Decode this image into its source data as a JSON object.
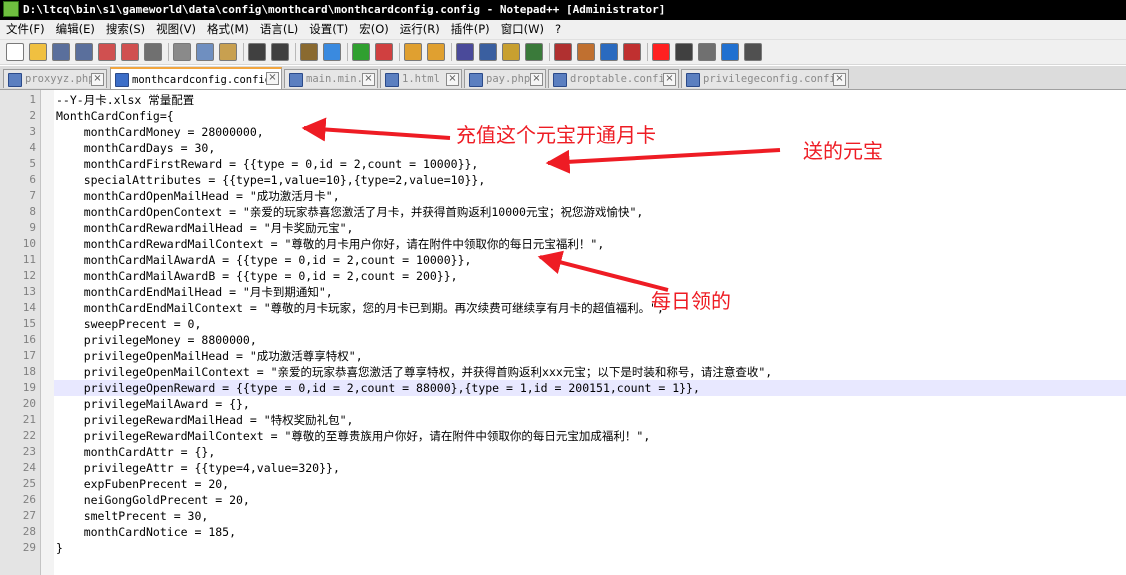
{
  "window": {
    "title": "D:\\ltcq\\bin\\s1\\gameworld\\data\\config\\monthcard\\monthcardconfig.config - Notepad++ [Administrator]"
  },
  "menu": [
    "文件(F)",
    "编辑(E)",
    "搜索(S)",
    "视图(V)",
    "格式(M)",
    "语言(L)",
    "设置(T)",
    "宏(O)",
    "运行(R)",
    "插件(P)",
    "窗口(W)",
    "?"
  ],
  "toolbar_icons": [
    "new-file-icon",
    "open-file-icon",
    "save-icon",
    "save-all-icon",
    "close-icon",
    "close-all-icon",
    "print-icon",
    "cut-icon",
    "copy-icon",
    "paste-icon",
    "undo-icon",
    "redo-icon",
    "find-icon",
    "replace-icon",
    "zoom-in-icon",
    "zoom-out-icon",
    "sync-vertical-icon",
    "sync-horizontal-icon",
    "word-wrap-icon",
    "show-all-chars-icon",
    "indent-guide-icon",
    "doc-map-icon",
    "function-list-icon",
    "folder-workspace-icon",
    "monitoring-icon",
    "preview-icon",
    "record-macro-icon",
    "stop-record-icon",
    "play-macro-icon",
    "run-macro-multiple-icon",
    "save-macro-icon"
  ],
  "tabs": [
    {
      "label": "proxyyz.php",
      "active": false
    },
    {
      "label": "monthcardconfig.config",
      "active": true
    },
    {
      "label": "main.min.js",
      "active": false
    },
    {
      "label": "1.html",
      "active": false
    },
    {
      "label": "pay.php",
      "active": false
    },
    {
      "label": "droptable.config",
      "active": false
    },
    {
      "label": "privilegeconfig.config",
      "active": false
    }
  ],
  "lines": [
    "--Y-月卡.xlsx 常量配置",
    "MonthCardConfig={",
    "    monthCardMoney = 28000000,",
    "    monthCardDays = 30,",
    "    monthCardFirstReward = {{type = 0,id = 2,count = 10000}},",
    "    specialAttributes = {{type=1,value=10},{type=2,value=10}},",
    "    monthCardOpenMailHead = \"成功激活月卡\",",
    "    monthCardOpenContext = \"亲爱的玩家恭喜您激活了月卡，并获得首购返利10000元宝；祝您游戏愉快\",",
    "    monthCardRewardMailHead = \"月卡奖励元宝\",",
    "    monthCardRewardMailContext = \"尊敬的月卡用户你好，请在附件中领取你的每日元宝福利！\",",
    "    monthCardMailAwardA = {{type = 0,id = 2,count = 10000}},",
    "    monthCardMailAwardB = {{type = 0,id = 2,count = 200}},",
    "    monthCardEndMailHead = \"月卡到期通知\",",
    "    monthCardEndMailContext = \"尊敬的月卡玩家，您的月卡已到期。再次续费可继续享有月卡的超值福利。\",",
    "    sweepPrecent = 0,",
    "    privilegeMoney = 8800000,",
    "    privilegeOpenMailHead = \"成功激活尊享特权\",",
    "    privilegeOpenMailContext = \"亲爱的玩家恭喜您激活了尊享特权，并获得首购返利xxx元宝；以下是时装和称号，请注意查收\",",
    "    privilegeOpenReward = {{type = 0,id = 2,count = 88000},{type = 1,id = 200151,count = 1}},",
    "    privilegeMailAward = {},",
    "    privilegeRewardMailHead = \"特权奖励礼包\",",
    "    privilegeRewardMailContext = \"尊敬的至尊贵族用户你好，请在附件中领取你的每日元宝加成福利！\",",
    "    monthCardAttr = {},",
    "    privilegeAttr = {{type=4,value=320}},",
    "    expFubenPrecent = 20,",
    "    neiGongGoldPrecent = 20,",
    "    smeltPrecent = 30,",
    "    monthCardNotice = 185,",
    "}"
  ],
  "highlighted_line": 19,
  "annotations": [
    {
      "text": "充值这个元宝开通月卡"
    },
    {
      "text": "送的元宝"
    },
    {
      "text": "每日领的"
    }
  ],
  "colors": {
    "annotation": "#ee1c24",
    "current_line": "#e8e8ff",
    "active_tab_accent": "#f2a640"
  }
}
